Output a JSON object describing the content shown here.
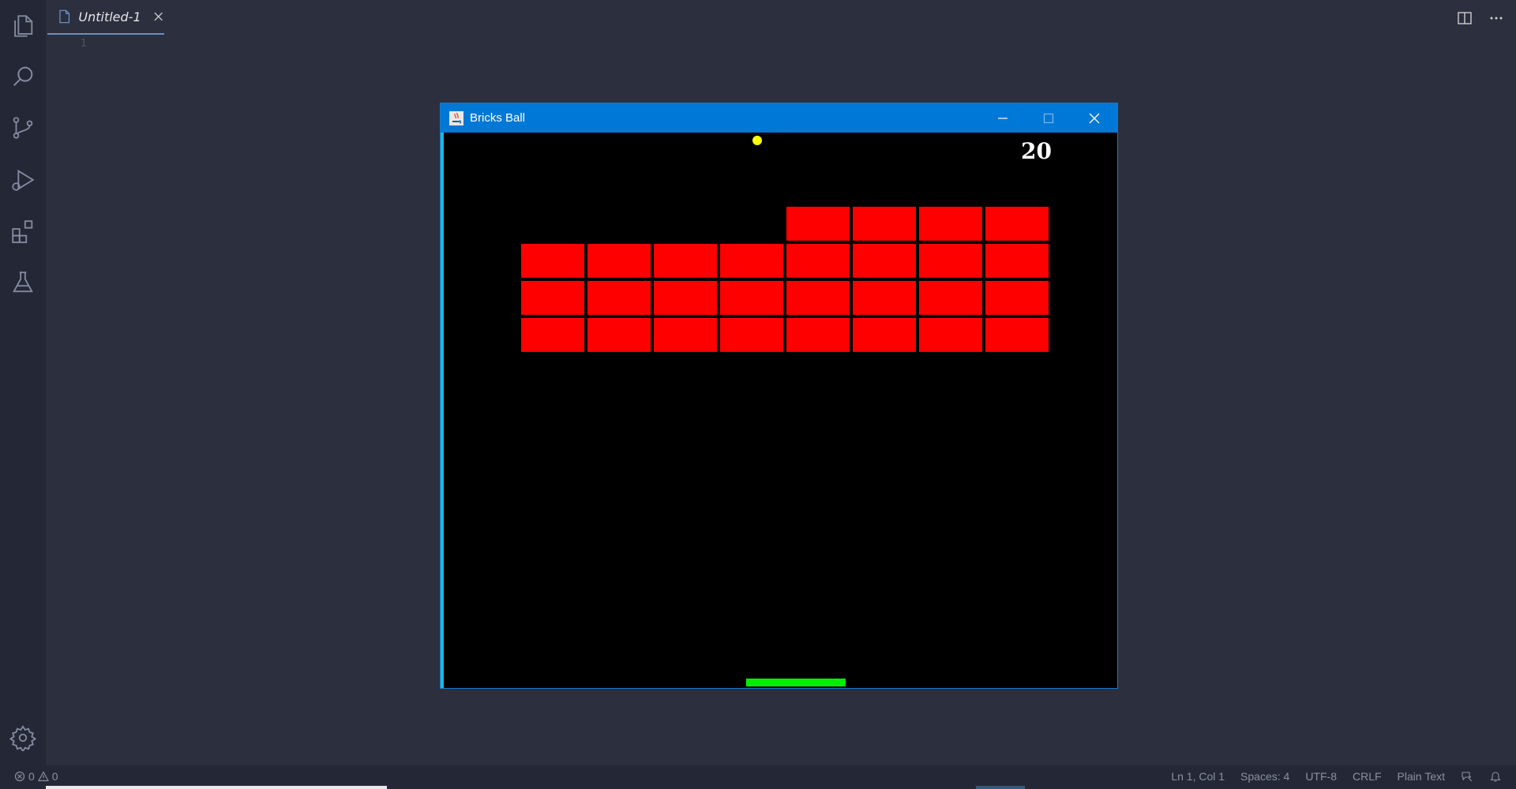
{
  "activity_bar": {
    "items": [
      {
        "icon": "explorer-icon"
      },
      {
        "icon": "search-icon"
      },
      {
        "icon": "source-control-icon"
      },
      {
        "icon": "run-debug-icon"
      },
      {
        "icon": "extensions-icon"
      },
      {
        "icon": "testing-icon"
      }
    ],
    "settings_icon": "gear-icon"
  },
  "editor": {
    "tab_label": "Untitled-1",
    "line_number": "1"
  },
  "game_window": {
    "title": "Bricks Ball",
    "score": "20",
    "colors": {
      "titlebar": "#0078d7",
      "brick": "#ff0000",
      "ball": "#ffff00",
      "paddle": "#00ee00",
      "background": "#000000"
    },
    "brick_rows": [
      [
        false,
        false,
        false,
        false,
        true,
        true,
        true,
        true
      ],
      [
        true,
        true,
        true,
        true,
        true,
        true,
        true,
        true
      ],
      [
        true,
        true,
        true,
        true,
        true,
        true,
        true,
        true
      ],
      [
        true,
        true,
        true,
        true,
        true,
        true,
        true,
        true
      ]
    ]
  },
  "status_bar": {
    "errors": "0",
    "warnings": "0",
    "position": "Ln 1, Col 1",
    "spaces": "Spaces: 4",
    "encoding": "UTF-8",
    "eol": "CRLF",
    "language": "Plain Text"
  }
}
